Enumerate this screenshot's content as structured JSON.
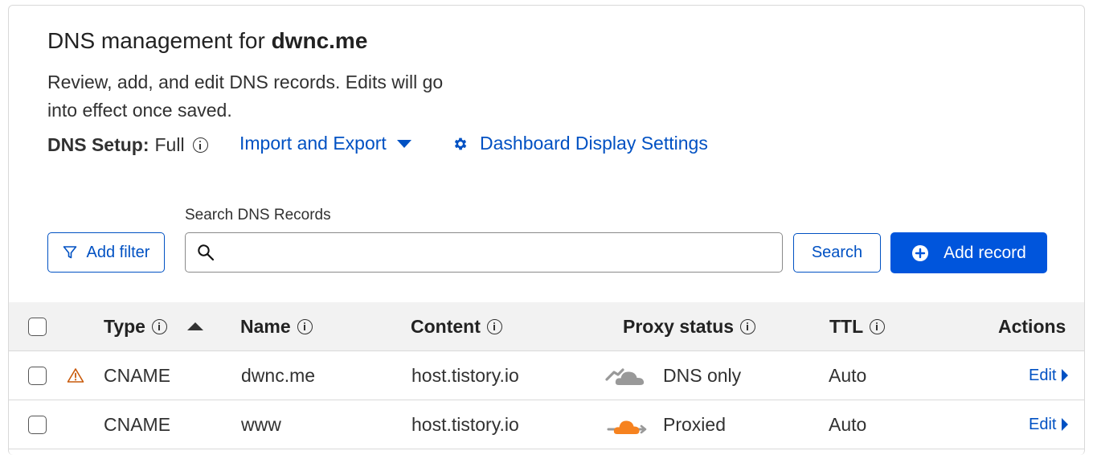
{
  "header": {
    "title_prefix": "DNS management for ",
    "domain": "dwnc.me",
    "description": "Review, add, and edit DNS records. Edits will go into effect once saved.",
    "setup_label": "DNS Setup:",
    "setup_value": "Full",
    "import_export_label": "Import and Export",
    "dashboard_settings_label": "Dashboard Display Settings"
  },
  "toolbar": {
    "search_label": "Search DNS Records",
    "search_value": "",
    "add_filter_label": "Add filter",
    "search_button_label": "Search",
    "add_record_label": "Add record"
  },
  "table": {
    "columns": {
      "type": "Type",
      "name": "Name",
      "content": "Content",
      "proxy_status": "Proxy status",
      "ttl": "TTL",
      "actions": "Actions"
    },
    "rows": [
      {
        "warning": true,
        "type": "CNAME",
        "name": "dwnc.me",
        "content": "host.tistory.io",
        "proxy_status": "DNS only",
        "cloud_icon": "grey-cloud-icon",
        "ttl": "Auto",
        "action": "Edit"
      },
      {
        "warning": false,
        "type": "CNAME",
        "name": "www",
        "content": "host.tistory.io",
        "proxy_status": "Proxied",
        "cloud_icon": "orange-cloud-icon",
        "ttl": "Auto",
        "action": "Edit"
      }
    ]
  },
  "colors": {
    "link": "#0051c3",
    "primary_button": "#0055dc",
    "header_bg": "#f2f2f2",
    "warning": "#c95a0a",
    "proxied_cloud": "#f6821f",
    "dns_only_cloud": "#999999"
  }
}
